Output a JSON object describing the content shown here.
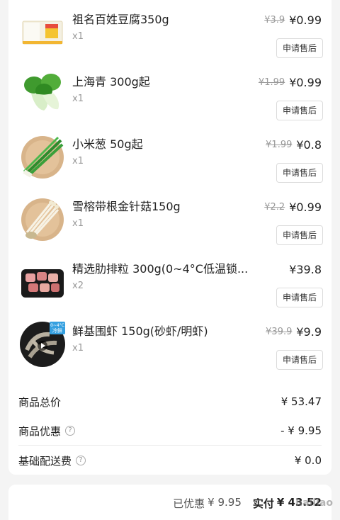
{
  "items": [
    {
      "name": "祖名百姓豆腐350g",
      "qty": "x1",
      "orig": "¥3.9",
      "price": "¥0.99",
      "btn": "申请售后",
      "icon": "tofu-box"
    },
    {
      "name": "上海青 300g起",
      "qty": "x1",
      "orig": "¥1.99",
      "price": "¥0.99",
      "btn": "申请售后",
      "icon": "bok-choy"
    },
    {
      "name": "小米葱 50g起",
      "qty": "x1",
      "orig": "¥1.99",
      "price": "¥0.8",
      "btn": "申请售后",
      "icon": "green-onion"
    },
    {
      "name": "雪榕带根金针菇150g",
      "qty": "x1",
      "orig": "¥2.2",
      "price": "¥0.99",
      "btn": "申请售后",
      "icon": "enoki"
    },
    {
      "name": "精选肋排粒 300g(0~4°C低温锁...",
      "qty": "x2",
      "orig": "",
      "price": "¥39.8",
      "btn": "申请售后",
      "icon": "pork-ribs"
    },
    {
      "name": "鲜基围虾 150g(砂虾/明虾)",
      "qty": "x1",
      "orig": "¥39.9",
      "price": "¥9.9",
      "btn": "申请售后",
      "icon": "shrimp",
      "badge_top": "0~4°C",
      "badge_bottom": "冷鲜"
    }
  ],
  "summary": {
    "total_label": "商品总价",
    "total_value": "¥ 53.47",
    "discount_label": "商品优惠",
    "discount_value": "- ¥ 9.95",
    "delivery_label": "基础配送费",
    "delivery_value": "¥ 0.0",
    "help_glyph": "?"
  },
  "footer": {
    "saved_label": "已优惠",
    "saved_value": "¥ 9.95",
    "paid_label": "实付",
    "paid_value": "¥ 43.52"
  },
  "watermark": "hailiao"
}
